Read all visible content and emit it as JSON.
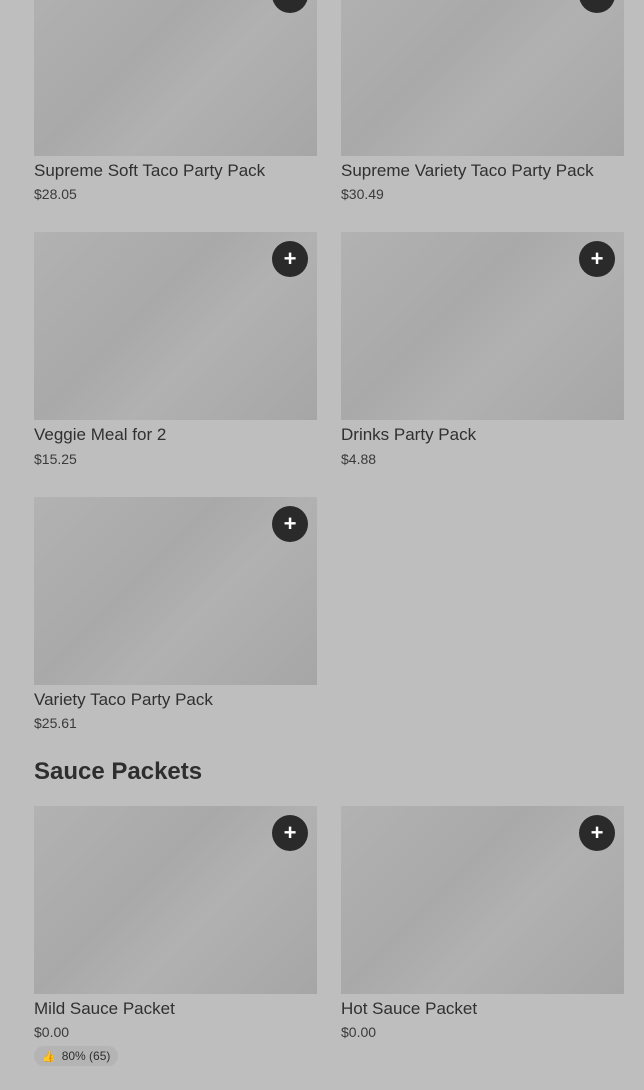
{
  "icons": {
    "add": "plus-icon",
    "thumbs_up": "thumbs-up-icon"
  },
  "add_symbol": "+",
  "thumbs_symbol": "👍",
  "party_packs": [
    {
      "name": "Supreme Soft Taco Party Pack",
      "price": "$28.05"
    },
    {
      "name": "Supreme Variety Taco Party Pack",
      "price": "$30.49"
    },
    {
      "name": "Veggie Meal for 2",
      "price": "$15.25"
    },
    {
      "name": "Drinks Party Pack",
      "price": "$4.88"
    },
    {
      "name": "Variety Taco Party Pack",
      "price": "$25.61"
    }
  ],
  "sauce_section": {
    "title": "Sauce Packets",
    "items": [
      {
        "name": "Mild Sauce Packet",
        "price": "$0.00",
        "rating": "80% (65)"
      },
      {
        "name": "Hot Sauce Packet",
        "price": "$0.00"
      }
    ]
  }
}
